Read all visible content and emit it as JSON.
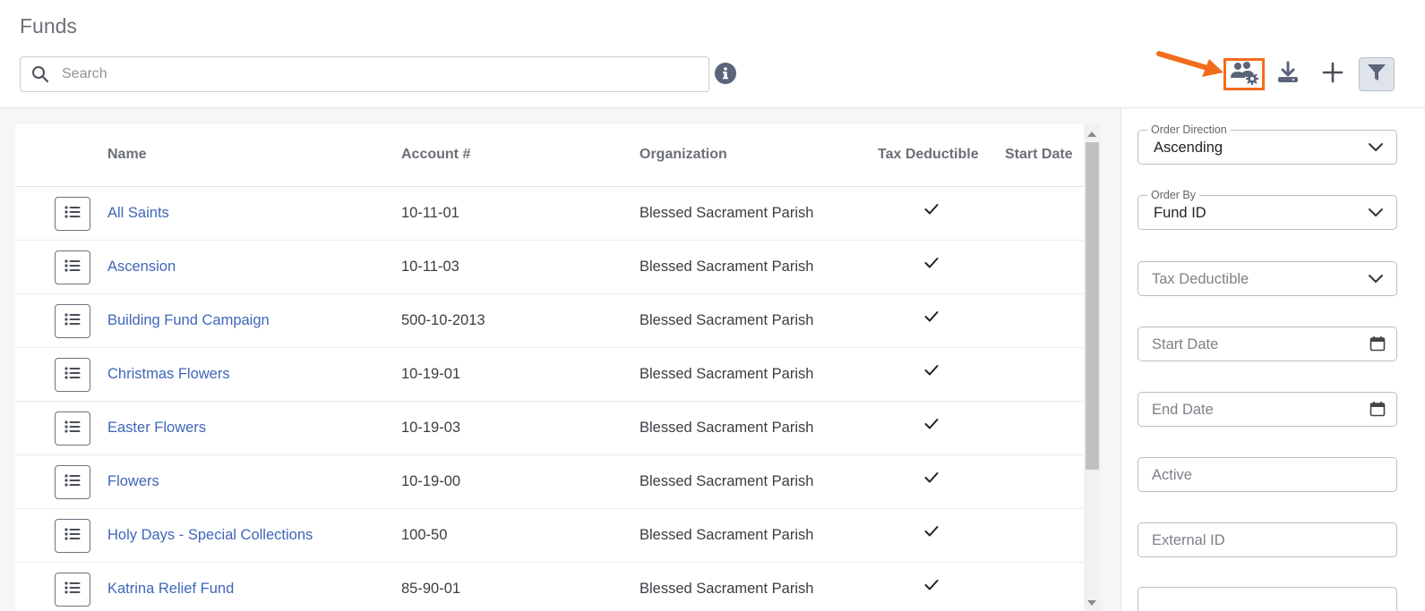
{
  "page": {
    "title": "Funds"
  },
  "search": {
    "placeholder": "Search",
    "value": ""
  },
  "colors": {
    "accent": "#3f66b8",
    "highlight": "#f36c1d",
    "icon": "#5b6478"
  },
  "table": {
    "headers": {
      "name": "Name",
      "account": "Account #",
      "organization": "Organization",
      "tax_deductible": "Tax Deductible",
      "start_date": "Start Date"
    },
    "rows": [
      {
        "name": "All Saints",
        "account": "10-11-01",
        "organization": "Blessed Sacrament Parish",
        "tax_deductible": true
      },
      {
        "name": "Ascension",
        "account": "10-11-03",
        "organization": "Blessed Sacrament Parish",
        "tax_deductible": true
      },
      {
        "name": "Building Fund Campaign",
        "account": "500-10-2013",
        "organization": "Blessed Sacrament Parish",
        "tax_deductible": true
      },
      {
        "name": "Christmas Flowers",
        "account": "10-19-01",
        "organization": "Blessed Sacrament Parish",
        "tax_deductible": true
      },
      {
        "name": "Easter Flowers",
        "account": "10-19-03",
        "organization": "Blessed Sacrament Parish",
        "tax_deductible": true
      },
      {
        "name": "Flowers",
        "account": "10-19-00",
        "organization": "Blessed Sacrament Parish",
        "tax_deductible": true
      },
      {
        "name": "Holy Days - Special Collections",
        "account": "100-50",
        "organization": "Blessed Sacrament Parish",
        "tax_deductible": true
      },
      {
        "name": "Katrina Relief Fund",
        "account": "85-90-01",
        "organization": "Blessed Sacrament Parish",
        "tax_deductible": true
      }
    ]
  },
  "filters": {
    "order_direction": {
      "label": "Order Direction",
      "value": "Ascending"
    },
    "order_by": {
      "label": "Order By",
      "value": "Fund ID"
    },
    "tax_deductible": {
      "placeholder": "Tax Deductible"
    },
    "start_date": {
      "placeholder": "Start Date"
    },
    "end_date": {
      "placeholder": "End Date"
    },
    "active": {
      "placeholder": "Active"
    },
    "external_id": {
      "placeholder": "External ID"
    }
  }
}
